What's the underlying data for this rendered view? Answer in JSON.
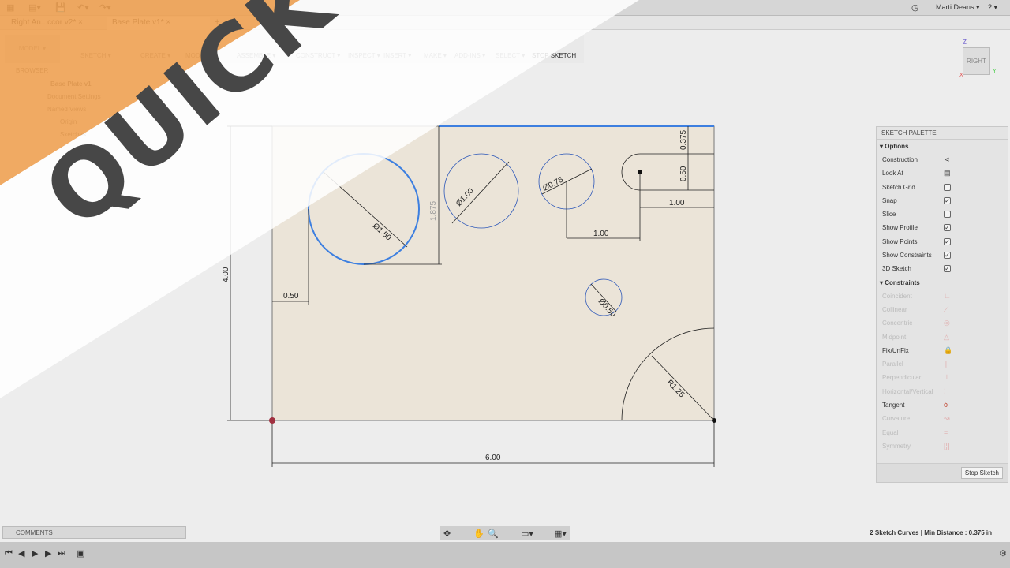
{
  "app": {
    "tabs": [
      {
        "label": "Right An...ccor v2*"
      },
      {
        "label": "Base Plate v1*"
      }
    ],
    "user": "Marti Deans ▾",
    "help": "? ▾"
  },
  "toolbar": {
    "workspace": "MODEL ▾",
    "groups": [
      "SKETCH ▾",
      "CREATE ▾",
      "MODIFY ▾",
      "ASSEMBLE ▾",
      "CONSTRUCT ▾",
      "INSPECT ▾",
      "INSERT ▾",
      "MAKE ▾",
      "ADD-INS ▾",
      "SELECT ▾",
      "STOP SKETCH"
    ]
  },
  "browser": {
    "title": "BROWSER",
    "items": [
      "Base Plate v1",
      "Document Settings",
      "Named Views",
      "Origin",
      "Sketches"
    ]
  },
  "viewcube": {
    "face": "RIGHT",
    "axes": {
      "z": "Z",
      "x": "X",
      "y": "Y"
    }
  },
  "sketch": {
    "dims": {
      "d150": "Ø1.50",
      "d100": "Ø1.00",
      "d075": "Ø0.75",
      "d050": "Ø0.50",
      "r125": "R1.25",
      "w600": "6.00",
      "h400": "4.00",
      "x050": "0.50",
      "y1875": "1.875",
      "x100a": "1.00",
      "x100b": "1.00",
      "y0375": "0.375",
      "y050": "0.50"
    },
    "colors": {
      "plate": "#ebe4d8",
      "selected": "#3d7fe0",
      "curve": "#2b56b8"
    }
  },
  "palette": {
    "title": "SKETCH PALETTE",
    "options_title": "Options",
    "options": [
      {
        "label": "Construction",
        "type": "icon",
        "icon": "construction-icon"
      },
      {
        "label": "Look At",
        "type": "icon",
        "icon": "look-at-icon"
      },
      {
        "label": "Sketch Grid",
        "checked": false
      },
      {
        "label": "Snap",
        "checked": true
      },
      {
        "label": "Slice",
        "checked": false
      },
      {
        "label": "Show Profile",
        "checked": true
      },
      {
        "label": "Show Points",
        "checked": true
      },
      {
        "label": "Show Constraints",
        "checked": true
      },
      {
        "label": "3D Sketch",
        "checked": true
      }
    ],
    "constraints_title": "Constraints",
    "constraints": [
      {
        "label": "Coincident",
        "enabled": false,
        "glyph": "∟"
      },
      {
        "label": "Collinear",
        "enabled": false,
        "glyph": "⟋"
      },
      {
        "label": "Concentric",
        "enabled": false,
        "glyph": "◎"
      },
      {
        "label": "Midpoint",
        "enabled": false,
        "glyph": "△"
      },
      {
        "label": "Fix/UnFix",
        "enabled": true,
        "glyph": "🔒"
      },
      {
        "label": "Parallel",
        "enabled": false,
        "glyph": "∥"
      },
      {
        "label": "Perpendicular",
        "enabled": false,
        "glyph": "⊥"
      },
      {
        "label": "Horizontal/Vertical",
        "enabled": false,
        "glyph": "⫶"
      },
      {
        "label": "Tangent",
        "enabled": true,
        "glyph": "ȯ"
      },
      {
        "label": "Curvature",
        "enabled": false,
        "glyph": "↝"
      },
      {
        "label": "Equal",
        "enabled": false,
        "glyph": "="
      },
      {
        "label": "Symmetry",
        "enabled": false,
        "glyph": "[¦]"
      }
    ],
    "stop_label": "Stop Sketch"
  },
  "comments": {
    "label": "COMMENTS"
  },
  "status": {
    "text": "2 Sketch Curves | Min Distance : 0.375 in"
  },
  "overlay": {
    "text": "QUICK TIP",
    "colors": {
      "orange": "#f0a050",
      "text": "#474747"
    }
  }
}
